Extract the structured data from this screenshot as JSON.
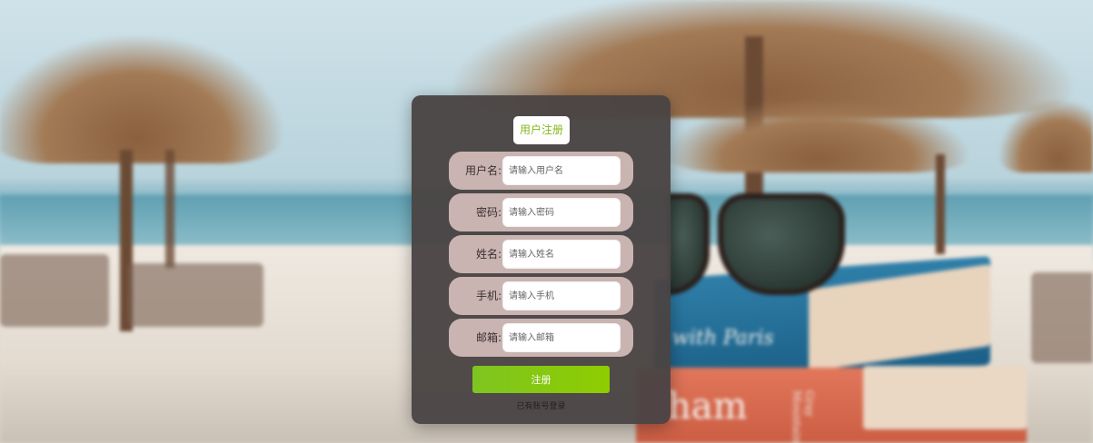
{
  "form": {
    "title": "用户注册",
    "fields": [
      {
        "label": "用户名:",
        "placeholder": "请输入用户名"
      },
      {
        "label": "密码:",
        "placeholder": "请输入密码"
      },
      {
        "label": "姓名:",
        "placeholder": "请输入姓名"
      },
      {
        "label": "手机:",
        "placeholder": "请输入手机"
      },
      {
        "label": "邮箱:",
        "placeholder": "请输入邮箱"
      }
    ],
    "submit_label": "注册",
    "login_link": "已有账号登录"
  },
  "background": {
    "book_text_1": "with Paris",
    "book_text_2": "ham",
    "book_text_3": "Gray Mountain"
  },
  "colors": {
    "accent": "#8fcc00",
    "panel": "#4a4444",
    "field_row": "#c9b4b1"
  }
}
